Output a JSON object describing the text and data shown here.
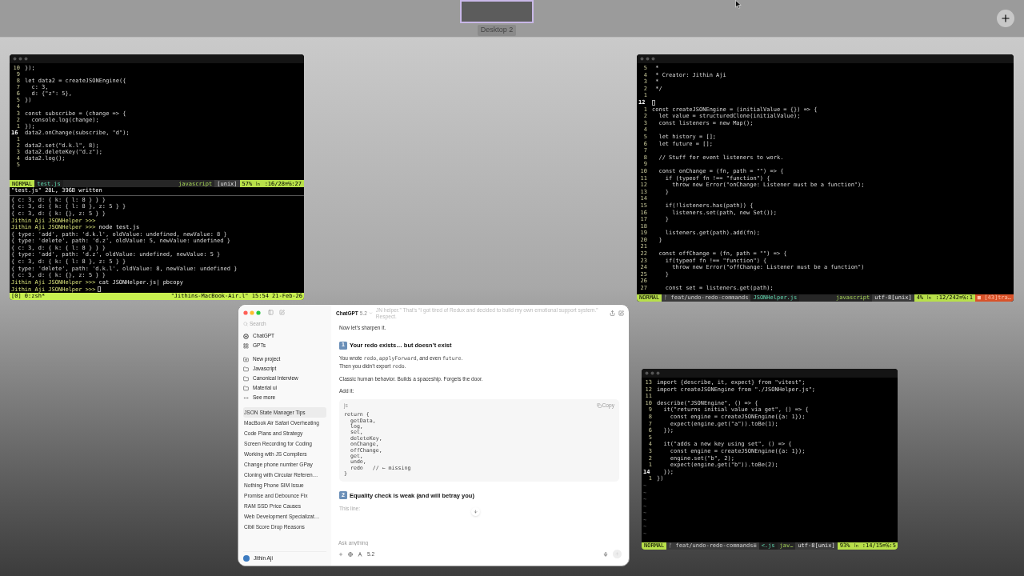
{
  "spaces_bar": {
    "desktops": [
      {
        "label": "Desktop 2",
        "selected": true
      }
    ]
  },
  "windows": [
    {
      "kind": "terminal",
      "lines": [
        {
          "num": "10",
          "text": "});",
          "current": false
        },
        {
          "num": "9",
          "current": false
        },
        {
          "num": "8",
          "text": "let data2 = createJSONEngine({",
          "current": false
        },
        {
          "num": "7",
          "text": "  c: 3,",
          "current": false
        },
        {
          "num": "6",
          "text": "  d: {\"z\": 5},",
          "current": false
        },
        {
          "num": "5",
          "text": "})",
          "current": false
        },
        {
          "num": "4",
          "current": false
        },
        {
          "num": "3",
          "text": "const subscribe = (change => {",
          "current": false
        },
        {
          "num": "2",
          "text": "  console.log(change);",
          "current": false
        },
        {
          "num": "1",
          "text": "});",
          "current": false
        },
        {
          "num": "16",
          "text": "data2.onChange(subscribe, \"d\");",
          "current": true
        },
        {
          "num": "1",
          "current": false
        },
        {
          "num": "2",
          "text": "data2.set(\"d.k.l\", 8);",
          "current": false
        },
        {
          "num": "3",
          "text": "data2.deleteKey(\"d.z\");",
          "current": false
        },
        {
          "num": "4",
          "text": "data2.log();",
          "current": false
        },
        {
          "num": "5",
          "current": false
        }
      ],
      "status": [
        {
          "kind": "mode",
          "text": "NORMAL"
        },
        {
          "kind": "file",
          "text": "test.js"
        },
        {
          "kind": "spacer"
        },
        {
          "kind": "filetype",
          "text": "javascript"
        },
        {
          "kind": "format",
          "text": "[unix]"
        },
        {
          "kind": "position",
          "text": "57% ㏑ :16/28≡℅:27"
        }
      ],
      "message": "\"test.js\" 28L, 396B written",
      "shell": [
        {
          "kind": "output",
          "text": "{ c: 3, d: { k: { l: 8 } } }"
        },
        {
          "kind": "output",
          "text": "{ c: 3, d: { k: { l: 8 }, z: 5 } }"
        },
        {
          "kind": "output",
          "text": "{ c: 3, d: { k: {}, z: 5 } }"
        },
        {
          "kind": "prompt",
          "prompt": "Jithin Aji JSONHelper >>>"
        },
        {
          "kind": "prompt",
          "prompt": "Jithin Aji JSONHelper >>>",
          "command": "node test.js"
        },
        {
          "kind": "output",
          "text": "{ type: 'add', path: 'd.k.l', oldValue: undefined, newValue: 8 }"
        },
        {
          "kind": "output",
          "text": "{ type: 'delete', path: 'd.z', oldValue: 5, newValue: undefined }"
        },
        {
          "kind": "output",
          "text": "{ c: 3, d: { k: { l: 8 } } }"
        },
        {
          "kind": "output",
          "text": "{ type: 'add', path: 'd.z', oldValue: undefined, newValue: 5 }"
        },
        {
          "kind": "output",
          "text": "{ c: 3, d: { k: { l: 8 }, z: 5 } }"
        },
        {
          "kind": "output",
          "text": "{ type: 'delete', path: 'd.k.l', oldValue: 8, newValue: undefined }"
        },
        {
          "kind": "output",
          "text": "{ c: 3, d: { k: {}, z: 5 } }"
        },
        {
          "kind": "prompt",
          "prompt": "Jithin Aji JSONHelper >>>",
          "command": "cat JSONHelper.js| pbcopy"
        },
        {
          "kind": "prompt",
          "prompt": "Jithin Aji JSONHelper >>>",
          "cursor": true
        }
      ],
      "tmux": {
        "left": "[0] 0:zsh*",
        "right": "\"Jithins-MacBook-Air.l\" 15:54 21-Feb-26"
      }
    },
    {
      "kind": "terminal",
      "lines": [
        {
          "num": "5",
          "text": " *",
          "current": false
        },
        {
          "num": "4",
          "text": " * Creator: Jithin Aji",
          "current": false
        },
        {
          "num": "3",
          "text": " *",
          "current": false
        },
        {
          "num": "2",
          "text": " */",
          "current": false
        },
        {
          "num": "1",
          "current": false
        },
        {
          "num": "12",
          "current": true
        },
        {
          "num": "1",
          "text": "const createJSONEngine = (initialValue = {}) => {",
          "current": false
        },
        {
          "num": "2",
          "text": "  let value = structuredClone(initialValue);",
          "current": false
        },
        {
          "num": "3",
          "text": "  const listeners = new Map();",
          "current": false
        },
        {
          "num": "4",
          "current": false
        },
        {
          "num": "5",
          "text": "  let history = [];",
          "current": false
        },
        {
          "num": "6",
          "text": "  let future = [];",
          "current": false
        },
        {
          "num": "7",
          "current": false
        },
        {
          "num": "8",
          "text": "  // Stuff for event listeners to work.",
          "current": false
        },
        {
          "num": "9",
          "current": false
        },
        {
          "num": "10",
          "text": "  const onChange = (fn, path = \"\") => {",
          "current": false
        },
        {
          "num": "11",
          "text": "    if (typeof fn !== \"function\") {",
          "current": false
        },
        {
          "num": "12",
          "text": "      throw new Error(\"onChange: Listener must be a function\");",
          "current": false
        },
        {
          "num": "13",
          "text": "    }",
          "current": false
        },
        {
          "num": "14",
          "current": false
        },
        {
          "num": "15",
          "text": "    if(!listeners.has(path)) {",
          "current": false
        },
        {
          "num": "16",
          "text": "      listeners.set(path, new Set());",
          "current": false
        },
        {
          "num": "17",
          "text": "    }",
          "current": false
        },
        {
          "num": "18",
          "current": false
        },
        {
          "num": "19",
          "text": "    listeners.get(path).add(fn);",
          "current": false
        },
        {
          "num": "20",
          "text": "  }",
          "current": false
        },
        {
          "num": "21",
          "current": false
        },
        {
          "num": "22",
          "text": "  const offChange = (fn, path = \"\") => {",
          "current": false
        },
        {
          "num": "23",
          "text": "    if(typeof fn !== \"function\") {",
          "current": false
        },
        {
          "num": "24",
          "text": "      throw new Error(\"offChange: Listener must be a function\")",
          "current": false
        },
        {
          "num": "25",
          "text": "    }",
          "current": false
        },
        {
          "num": "26",
          "current": false
        },
        {
          "num": "27",
          "text": "    const set = listeners.get(path);",
          "current": false
        }
      ],
      "status": [
        {
          "kind": "mode",
          "text": "NORMAL"
        },
        {
          "kind": "branch",
          "text": "ᚠ feat/undo-redo-commands"
        },
        {
          "kind": "file",
          "text": "JSONHelper.js"
        },
        {
          "kind": "spacer"
        },
        {
          "kind": "filetype",
          "text": "javascript"
        },
        {
          "kind": "format",
          "text": "utf-8[unix]"
        },
        {
          "kind": "position",
          "text": "4% ㏑ :12/242≡℅:1"
        },
        {
          "kind": "warning",
          "text": "■ [43]tra…"
        }
      ]
    },
    {
      "kind": "terminal",
      "lines": [
        {
          "num": "13",
          "text": "import {describe, it, expect} from \"vitest\";",
          "current": false
        },
        {
          "num": "12",
          "text": "import createJSONEngine from \"./JSONHelper.js\";",
          "current": false
        },
        {
          "num": "11",
          "current": false
        },
        {
          "num": "10",
          "text": "describe(\"JSONEngine\", () => {",
          "current": false
        },
        {
          "num": "9",
          "text": "  it(\"returns initial value via get\", () => {",
          "current": false
        },
        {
          "num": "8",
          "text": "    const engine = createJSONEngine({a: 1});",
          "current": false
        },
        {
          "num": "7",
          "text": "    expect(engine.get(\"a\")).toBe(1);",
          "current": false
        },
        {
          "num": "6",
          "text": "  });",
          "current": false
        },
        {
          "num": "5",
          "current": false
        },
        {
          "num": "4",
          "text": "  it(\"adds a new key using set\", () => {",
          "current": false
        },
        {
          "num": "3",
          "text": "    const engine = createJSONEngine({a: 1});",
          "current": false
        },
        {
          "num": "2",
          "text": "    engine.set(\"b\", 2);",
          "current": false
        },
        {
          "num": "1",
          "text": "    expect(engine.get(\"b\")).toBe(2);",
          "current": false
        },
        {
          "num": "14",
          "text": "  });",
          "current": true
        },
        {
          "num": "1",
          "text": "})",
          "current": false
        }
      ],
      "tildes": [
        "~",
        "~",
        "~",
        "~",
        "~",
        "~",
        "~",
        "~"
      ],
      "status": [
        {
          "kind": "mode",
          "text": "NORMAL"
        },
        {
          "kind": "branch",
          "text": "ᚠ feat/undo-redo-commands≣"
        },
        {
          "kind": "file",
          "text": "<.js"
        },
        {
          "kind": "filetype",
          "text": "jav…"
        },
        {
          "kind": "format",
          "text": "utf-8[unix]"
        },
        {
          "kind": "position",
          "text": "93% ㏑ :14/15≡℅:5"
        }
      ]
    }
  ],
  "chat": {
    "sidebar": {
      "search": {
        "placeholder": "Search"
      },
      "nav": [
        {
          "kind": "chatgpt",
          "label": "ChatGPT"
        },
        {
          "kind": "gpts",
          "label": "GPTs"
        }
      ],
      "projects": [
        {
          "kind": "new",
          "label": "New project"
        },
        {
          "kind": "folder",
          "label": "Javascript"
        },
        {
          "kind": "folder",
          "label": "Canonical Interview"
        },
        {
          "kind": "folder",
          "label": "Material ui"
        },
        {
          "kind": "more",
          "label": "See more"
        }
      ],
      "history": [
        {
          "label": "JSON State Manager Tips",
          "selected": true
        },
        {
          "label": "MacBook Air Safari Overheating",
          "selected": false
        },
        {
          "label": "Code Plans and Strategy",
          "selected": false
        },
        {
          "label": "Screen Recording for Coding",
          "selected": false
        },
        {
          "label": "Working with JS Compilers",
          "selected": false
        },
        {
          "label": "Change phone number GPay",
          "selected": false
        },
        {
          "label": "Cloning with Circular Referen…",
          "selected": false
        },
        {
          "label": "Nothing Phone SIM Issue",
          "selected": false
        },
        {
          "label": "Promise and Debounce Fix",
          "selected": false
        },
        {
          "label": "RAM SSD Price Causes",
          "selected": false
        },
        {
          "label": "Web Development Specializat…",
          "selected": false
        },
        {
          "label": "Cibil Score Drop Reasons",
          "selected": false
        }
      ],
      "user": "Jithin Aji"
    },
    "header": {
      "title": "ChatGPT",
      "model": "5.2",
      "banner": "JN helper.” That’s “I got tired of Redux and decided to build my own emotional support system.” Respect."
    },
    "blocks": [
      {
        "kind": "paragraph",
        "lines": [
          [
            {
              "kind": "text",
              "text": "Now let's sharpen it."
            }
          ]
        ]
      },
      {
        "kind": "heading",
        "badge": "1",
        "text": "Your redo exists… but doesn’t exist"
      },
      {
        "kind": "paragraph",
        "lines": [
          [
            {
              "kind": "text",
              "text": "You wrote "
            },
            {
              "kind": "code",
              "text": "redo"
            },
            {
              "kind": "text",
              "text": ", "
            },
            {
              "kind": "code",
              "text": "applyForward"
            },
            {
              "kind": "text",
              "text": ", and even "
            },
            {
              "kind": "code",
              "text": "future"
            },
            {
              "kind": "text",
              "text": "."
            }
          ],
          [
            {
              "kind": "text",
              "text": "Then you didn’t export "
            },
            {
              "kind": "code",
              "text": "redo"
            },
            {
              "kind": "text",
              "text": "."
            }
          ]
        ]
      },
      {
        "kind": "paragraph",
        "lines": [
          [
            {
              "kind": "text",
              "text": "Classic human behavior. Builds a spaceship. Forgets the door."
            }
          ]
        ]
      },
      {
        "kind": "paragraph",
        "lines": [
          [
            {
              "kind": "text",
              "text": "Add it:"
            }
          ]
        ]
      },
      {
        "kind": "code_block",
        "lang": "js",
        "copy": "Copy",
        "lines": [
          "return {",
          "  getData,",
          "  log,",
          "  set,",
          "  deleteKey,",
          "  onChange,",
          "  offChange,",
          "  get,",
          "  undo,",
          "  redo   // ← missing",
          "}"
        ]
      },
      {
        "kind": "heading",
        "badge": "2",
        "text": "Equality check is weak (and will betray you)"
      },
      {
        "kind": "faded",
        "lines": [
          [
            {
              "kind": "text",
              "text": "This line:"
            }
          ]
        ]
      }
    ],
    "composer": {
      "placeholder": "Ask anything",
      "model": "5.2"
    }
  }
}
